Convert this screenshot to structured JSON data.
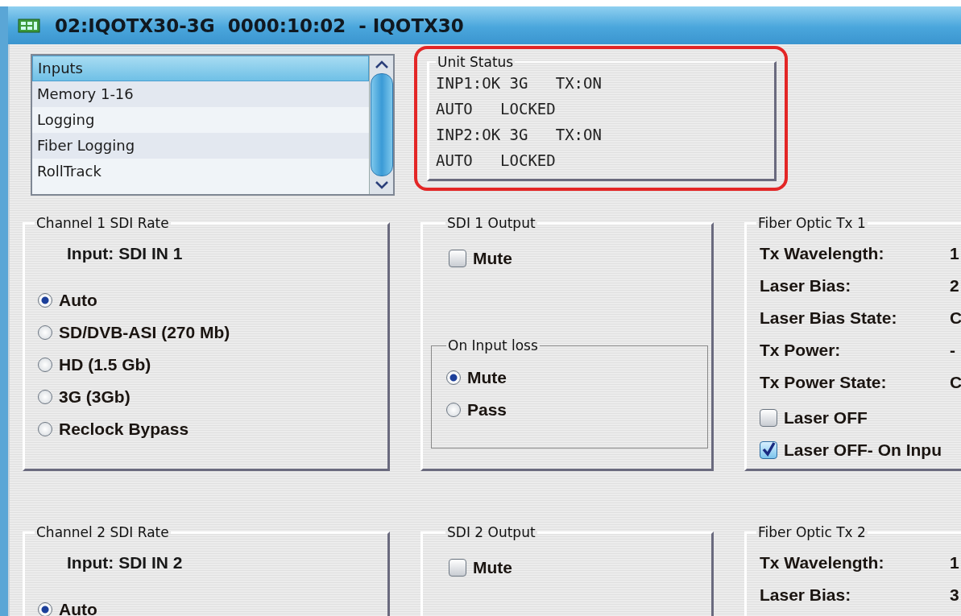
{
  "window": {
    "title": "02:IQOTX30-3G  0000:10:02  - IQOTX30"
  },
  "menu_list": {
    "items": [
      {
        "label": "Inputs",
        "selected": true
      },
      {
        "label": "Memory 1-16",
        "selected": false
      },
      {
        "label": "Logging",
        "selected": false
      },
      {
        "label": "Fiber Logging",
        "selected": false
      },
      {
        "label": "RollTrack",
        "selected": false
      }
    ]
  },
  "unit_status": {
    "title": "Unit Status",
    "highlighted": true,
    "lines": [
      "INP1:OK 3G   TX:ON",
      "AUTO   LOCKED",
      "INP2:OK 3G   TX:ON",
      "AUTO   LOCKED"
    ]
  },
  "channels": [
    {
      "rate": {
        "title": "Channel 1 SDI Rate",
        "input": "Input: SDI IN 1",
        "options": [
          {
            "label": "Auto",
            "selected": true
          },
          {
            "label": "SD/DVB-ASI (270 Mb)",
            "selected": false
          },
          {
            "label": "HD (1.5 Gb)",
            "selected": false
          },
          {
            "label": "3G (3Gb)",
            "selected": false
          },
          {
            "label": "Reclock Bypass",
            "selected": false
          }
        ]
      },
      "output": {
        "title": "SDI 1 Output",
        "mute": {
          "label": "Mute",
          "checked": false
        },
        "input_loss": {
          "title": "On Input loss",
          "options": [
            {
              "label": "Mute",
              "selected": true
            },
            {
              "label": "Pass",
              "selected": false
            }
          ]
        }
      },
      "fiber": {
        "title": "Fiber Optic Tx 1",
        "fields": [
          {
            "label": "Tx Wavelength:",
            "value": "1"
          },
          {
            "label": "Laser Bias:",
            "value": "2"
          },
          {
            "label": "Laser Bias State:",
            "value": "C"
          },
          {
            "label": "Tx Power:",
            "value": "-"
          },
          {
            "label": "Tx Power State:",
            "value": "C"
          }
        ],
        "checkboxes": [
          {
            "label": "Laser OFF",
            "checked": false
          },
          {
            "label": "Laser OFF- On Inpu",
            "checked": true
          }
        ]
      }
    },
    {
      "rate": {
        "title": "Channel 2 SDI Rate",
        "input": "Input: SDI IN 2",
        "options": [
          {
            "label": "Auto",
            "selected": true
          }
        ]
      },
      "output": {
        "title": "SDI 2 Output",
        "mute": {
          "label": "Mute",
          "checked": false
        }
      },
      "fiber": {
        "title": "Fiber Optic Tx 2",
        "fields": [
          {
            "label": "Tx Wavelength:",
            "value": "1"
          },
          {
            "label": "Laser Bias:",
            "value": "3"
          }
        ]
      }
    }
  ]
}
